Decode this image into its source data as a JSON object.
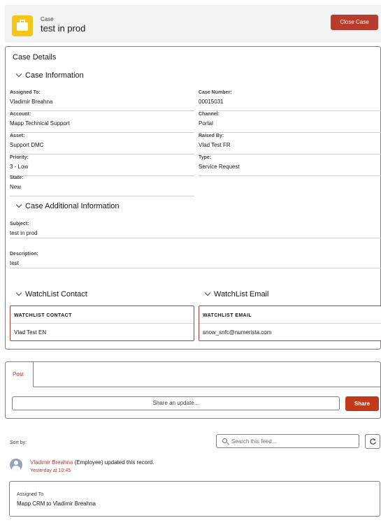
{
  "header": {
    "object_label": "Case",
    "record_title": "test in prod",
    "close_button": "Close Case"
  },
  "details": {
    "card_title": "Case Details",
    "case_info_title": "Case Information",
    "fields": {
      "assigned_to": {
        "label": "Assigned To:",
        "value": "Vladimir Breahna"
      },
      "case_number": {
        "label": "Case Number:",
        "value": "00015031"
      },
      "account": {
        "label": "Account:",
        "value": "Mapp Technical Support"
      },
      "channel": {
        "label": "Channel:",
        "value": "Portal"
      },
      "asset": {
        "label": "Asset:",
        "value": "Support DMC"
      },
      "raised_by": {
        "label": "Raised By:",
        "value": "Vlad Test FR"
      },
      "priority": {
        "label": "Priority:",
        "value": "3 - Low"
      },
      "type": {
        "label": "Type:",
        "value": "Service Request"
      },
      "state": {
        "label": "State:",
        "value": "New"
      }
    },
    "additional_title": "Case Additional Information",
    "subject": {
      "label": "Subject:",
      "value": "test in prod"
    },
    "description": {
      "label": "Description:",
      "value": "test"
    },
    "watchlist_contact": {
      "title": "WatchList Contact",
      "header": "WATCHLIST CONTACT",
      "value": "Vlad Test EN"
    },
    "watchlist_email": {
      "title": "WatchList Email",
      "header": "WATCHLIST EMAIL",
      "value": "snow_snfc@numerista.com"
    }
  },
  "publisher": {
    "tab": "Post",
    "placeholder": "Share an update...",
    "share_button": "Share"
  },
  "feed": {
    "sort_by": "Sort by:",
    "search_placeholder": "Search this feed...",
    "item": {
      "user": "Vladimir Breahna",
      "text": " (Employee) updated this record.",
      "time": "Yesterday at 10:45",
      "change_label": "Assigned To",
      "change_value": "Mapp CRM to Vladimir Breahna"
    }
  },
  "colors": {
    "brand_red": "#b83c2d",
    "case_icon": "#f5c518"
  }
}
